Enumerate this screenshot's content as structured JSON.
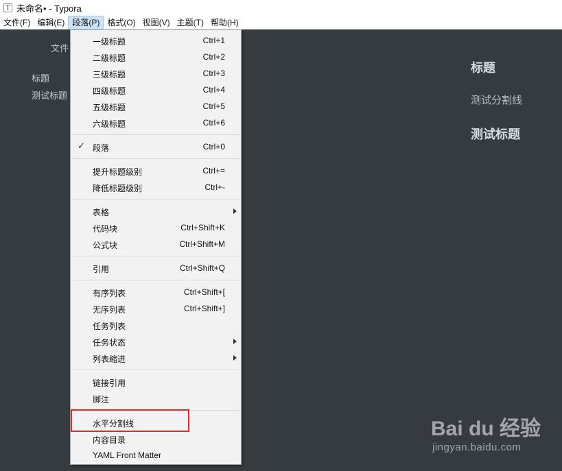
{
  "window": {
    "app_icon_glyph": "T",
    "title": "未命名• - Typora"
  },
  "menubar": {
    "items": [
      "文件(F)",
      "编辑(E)",
      "段落(P)",
      "格式(O)",
      "视图(V)",
      "主题(T)",
      "帮助(H)"
    ],
    "active_index": 2
  },
  "sidebar": {
    "tab_label": "文件",
    "outline": [
      "标题",
      "测试标题"
    ]
  },
  "document": {
    "lines": [
      "标题",
      "测试分割线",
      "测试标题"
    ]
  },
  "paragraph_menu": {
    "items": [
      {
        "label": "一级标题",
        "shortcut": "Ctrl+1"
      },
      {
        "label": "二级标题",
        "shortcut": "Ctrl+2"
      },
      {
        "label": "三级标题",
        "shortcut": "Ctrl+3"
      },
      {
        "label": "四级标题",
        "shortcut": "Ctrl+4"
      },
      {
        "label": "五级标题",
        "shortcut": "Ctrl+5"
      },
      {
        "label": "六级标题",
        "shortcut": "Ctrl+6"
      },
      {
        "label": "段落",
        "shortcut": "Ctrl+0",
        "checked": true
      },
      {
        "label": "提升标题级别",
        "shortcut": "Ctrl+="
      },
      {
        "label": "降低标题级别",
        "shortcut": "Ctrl+-"
      },
      {
        "label": "表格",
        "shortcut": "",
        "submenu": true
      },
      {
        "label": "代码块",
        "shortcut": "Ctrl+Shift+K"
      },
      {
        "label": "公式块",
        "shortcut": "Ctrl+Shift+M"
      },
      {
        "label": "引用",
        "shortcut": "Ctrl+Shift+Q"
      },
      {
        "label": "有序列表",
        "shortcut": "Ctrl+Shift+["
      },
      {
        "label": "无序列表",
        "shortcut": "Ctrl+Shift+]"
      },
      {
        "label": "任务列表",
        "shortcut": ""
      },
      {
        "label": "任务状态",
        "shortcut": "",
        "submenu": true
      },
      {
        "label": "列表缩进",
        "shortcut": "",
        "submenu": true
      },
      {
        "label": "链接引用",
        "shortcut": ""
      },
      {
        "label": "脚注",
        "shortcut": ""
      },
      {
        "label": "水平分割线",
        "shortcut": "",
        "highlighted": true
      },
      {
        "label": "内容目录",
        "shortcut": ""
      },
      {
        "label": "YAML Front Matter",
        "shortcut": ""
      }
    ],
    "check_glyph": "✓"
  },
  "watermark": {
    "brand": "Bai du 经验",
    "url": "jingyan.baidu.com"
  },
  "colors": {
    "editor_bg": "#363b40",
    "menu_bg": "#f2f2f2",
    "highlight_border": "#e02b2b",
    "active_menu_bg": "#cce4f7"
  }
}
